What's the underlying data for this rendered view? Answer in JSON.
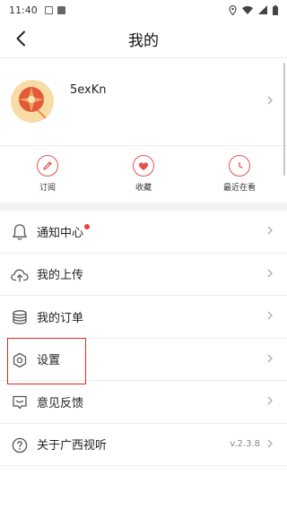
{
  "status_bar": {
    "time": "11:40"
  },
  "header": {
    "title": "我的"
  },
  "profile": {
    "username": "5exKn"
  },
  "quick_actions": [
    {
      "label": "订阅",
      "icon": "pencil-icon"
    },
    {
      "label": "收藏",
      "icon": "heart-icon"
    },
    {
      "label": "最近在看",
      "icon": "clock-icon"
    }
  ],
  "menu": {
    "notifications": {
      "label": "通知中心",
      "icon": "bell-icon",
      "has_dot": true
    },
    "uploads": {
      "label": "我的上传",
      "icon": "upload-cloud-icon"
    },
    "orders": {
      "label": "我的订单",
      "icon": "coin-stack-icon"
    },
    "settings": {
      "label": "设置",
      "icon": "hexagon-settings-icon"
    },
    "feedback": {
      "label": "意见反馈",
      "icon": "feedback-icon"
    },
    "about": {
      "label": "关于广西视听",
      "icon": "question-icon",
      "version": "v.2.3.8"
    }
  },
  "colors": {
    "accent": "#e2534f",
    "highlight_box": "#e8261d",
    "notification_dot": "#e94040"
  }
}
